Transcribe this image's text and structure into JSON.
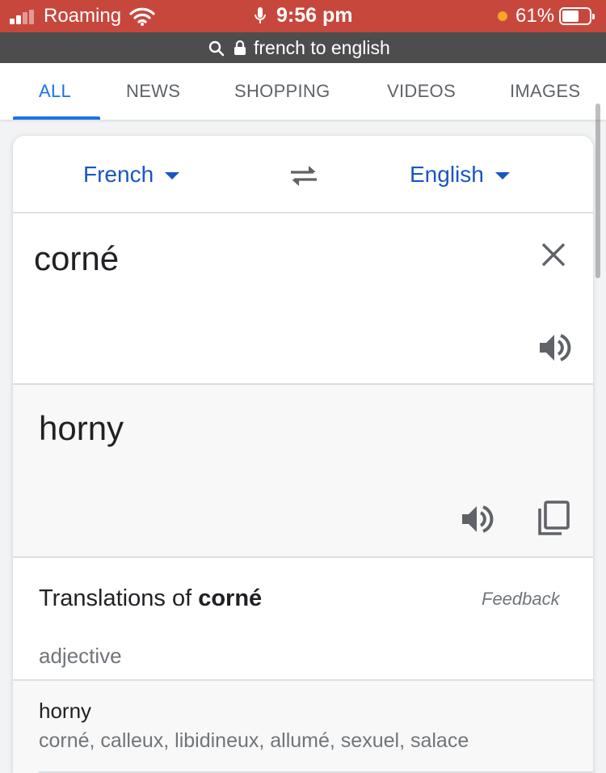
{
  "status_bar": {
    "carrier": "Roaming",
    "time": "9:56 pm",
    "battery_percent": "61%",
    "battery_level": 0.61,
    "icons": [
      "signal-icon",
      "wifi-icon",
      "mic-icon",
      "orange-dot",
      "battery-icon"
    ],
    "background": "#c8473d"
  },
  "url_bar": {
    "text": "french to english",
    "icons": [
      "search-icon",
      "lock-icon"
    ]
  },
  "tabs": [
    {
      "label": "ALL",
      "active": true
    },
    {
      "label": "NEWS",
      "active": false
    },
    {
      "label": "SHOPPING",
      "active": false
    },
    {
      "label": "VIDEOS",
      "active": false
    },
    {
      "label": "IMAGES",
      "active": false
    }
  ],
  "translator": {
    "source_lang": "French",
    "target_lang": "English",
    "source_text": "corné",
    "target_text": "horny",
    "icons": [
      "swap-icon",
      "clear-icon",
      "speaker-icon",
      "copy-icon"
    ],
    "accent": "#1a55c4"
  },
  "translations": {
    "title_prefix": "Translations of ",
    "title_word": "corné",
    "feedback": "Feedback",
    "part_of_speech": "adjective",
    "entries": [
      {
        "word": "horny",
        "synonyms": "corné, calleux, libidineux, allumé, sexuel, salace"
      }
    ]
  }
}
